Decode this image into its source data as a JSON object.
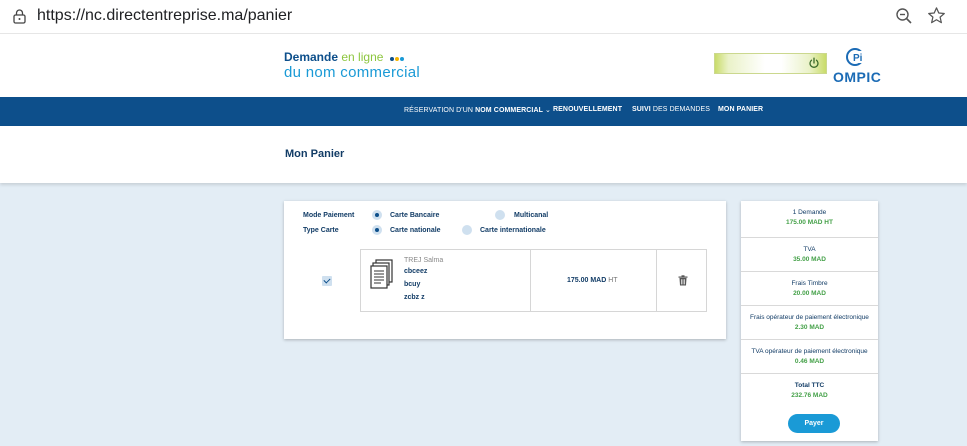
{
  "browser": {
    "url": "https://nc.directentreprise.ma/panier"
  },
  "header": {
    "logo_line1_main": "Demande",
    "logo_line1_accent": "en ligne",
    "logo_line2": "du nom commercial",
    "ompic_label": "OMPIC",
    "colors": {
      "primary": "#0d4f8b",
      "accent_green": "#8dc63f",
      "accent_blue": "#1a9ad6"
    }
  },
  "nav": {
    "items": [
      {
        "light": "RÉSERVATION D'UN ",
        "bold": "NOM COMMERCIAL",
        "suffix": " ⌄"
      },
      {
        "light": "",
        "bold": "RENOUVELLEMENT",
        "suffix": ""
      },
      {
        "light": " DES DEMANDES",
        "bold": "SUIVI",
        "suffix": ""
      },
      {
        "light": " PANIER",
        "bold": "MON",
        "suffix": ""
      }
    ]
  },
  "page": {
    "title": "Mon Panier"
  },
  "payment": {
    "mode_label": "Mode Paiement",
    "mode_options": [
      {
        "label": "Carte Bancaire",
        "selected": true
      },
      {
        "label": "Multicanal",
        "selected": false
      }
    ],
    "type_label": "Type Carte",
    "type_options": [
      {
        "label": "Carte nationale",
        "selected": true
      },
      {
        "label": "Carte internationale",
        "selected": false
      }
    ]
  },
  "cart": {
    "items": [
      {
        "checked": true,
        "owner": "TREJ Salma",
        "names": [
          "cbceez",
          "bcuy",
          "zcbz z"
        ],
        "price": "175.00 MAD",
        "price_unit": "HT"
      }
    ]
  },
  "summary": {
    "rows": [
      {
        "label": "1 Demande",
        "value": "175.00 MAD HT"
      },
      {
        "label": "TVA",
        "value": "35.00 MAD"
      },
      {
        "label": "Frais Timbre",
        "value": "20.00 MAD"
      },
      {
        "label": "Frais opérateur de paiement électronique",
        "value": "2.30 MAD"
      },
      {
        "label": "TVA opérateur de paiement électronique",
        "value": "0.46 MAD"
      },
      {
        "label": "Total TTC",
        "value": "232.76 MAD"
      }
    ],
    "pay_label": "Payer"
  }
}
